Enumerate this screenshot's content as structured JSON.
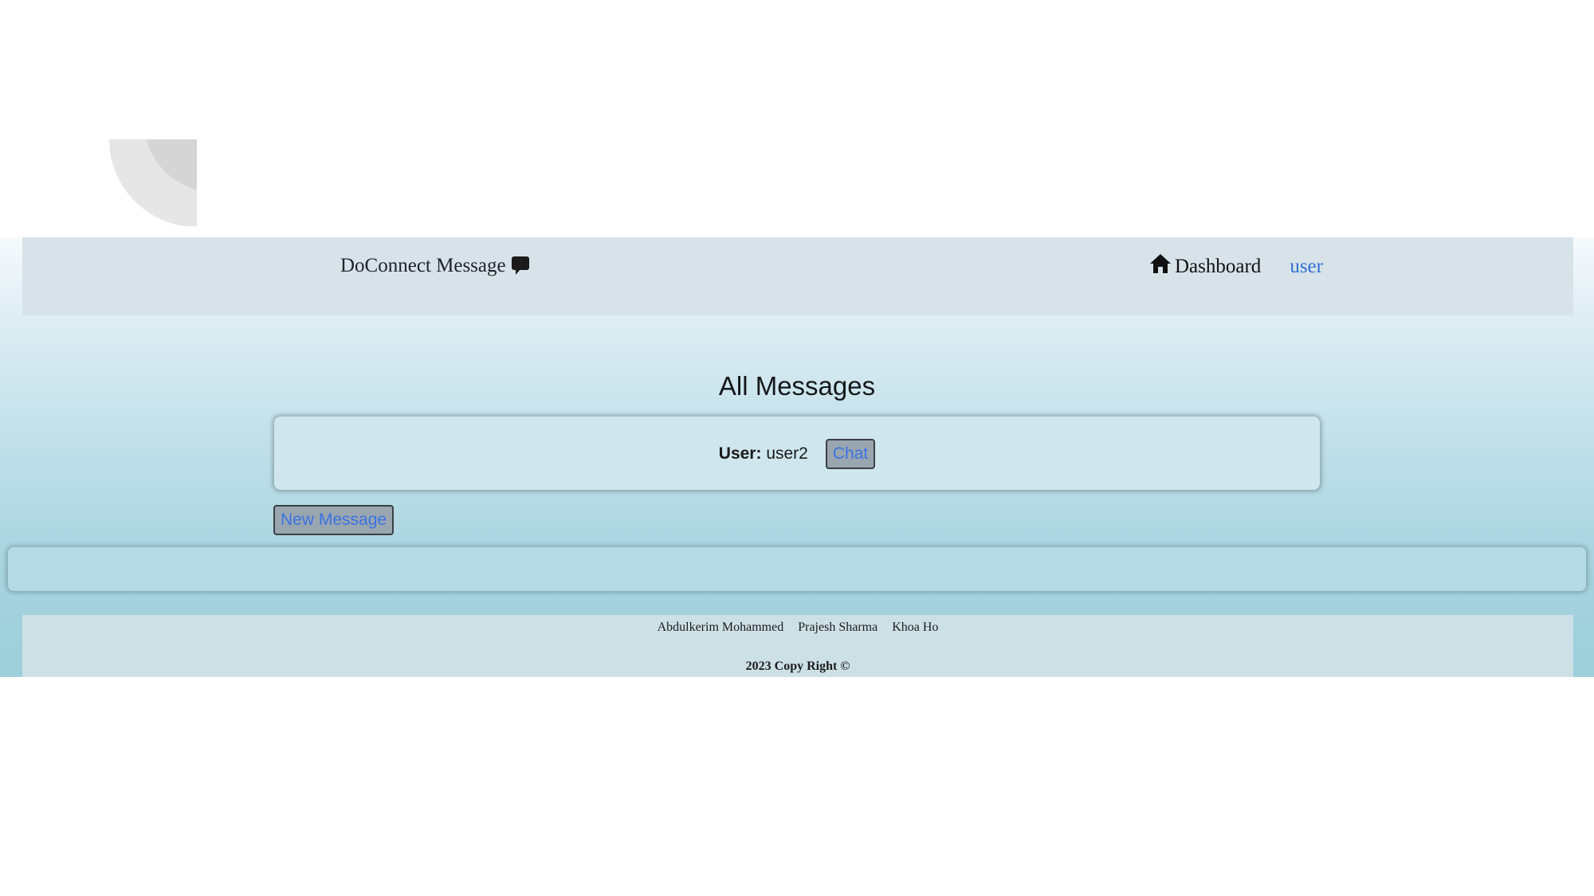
{
  "navbar": {
    "brand": "DoConnect Message",
    "brand_icon": "message-icon",
    "dashboard_label": "Dashboard",
    "dashboard_icon": "home-icon",
    "user_link": "user"
  },
  "page": {
    "title": "All Messages"
  },
  "messages": [
    {
      "user_label": "User:",
      "user_name": "user2",
      "chat_button": "Chat"
    }
  ],
  "actions": {
    "new_message": "New Message"
  },
  "footer": {
    "authors": [
      "Abdulkerim Mohammed",
      "Prajesh Sharma",
      "Khoa Ho"
    ],
    "copyright": "2023 Copy Right ©"
  },
  "colors": {
    "link": "#2f6fd6",
    "button_text": "#3a73e3",
    "button_bg": "#9aa6af"
  }
}
